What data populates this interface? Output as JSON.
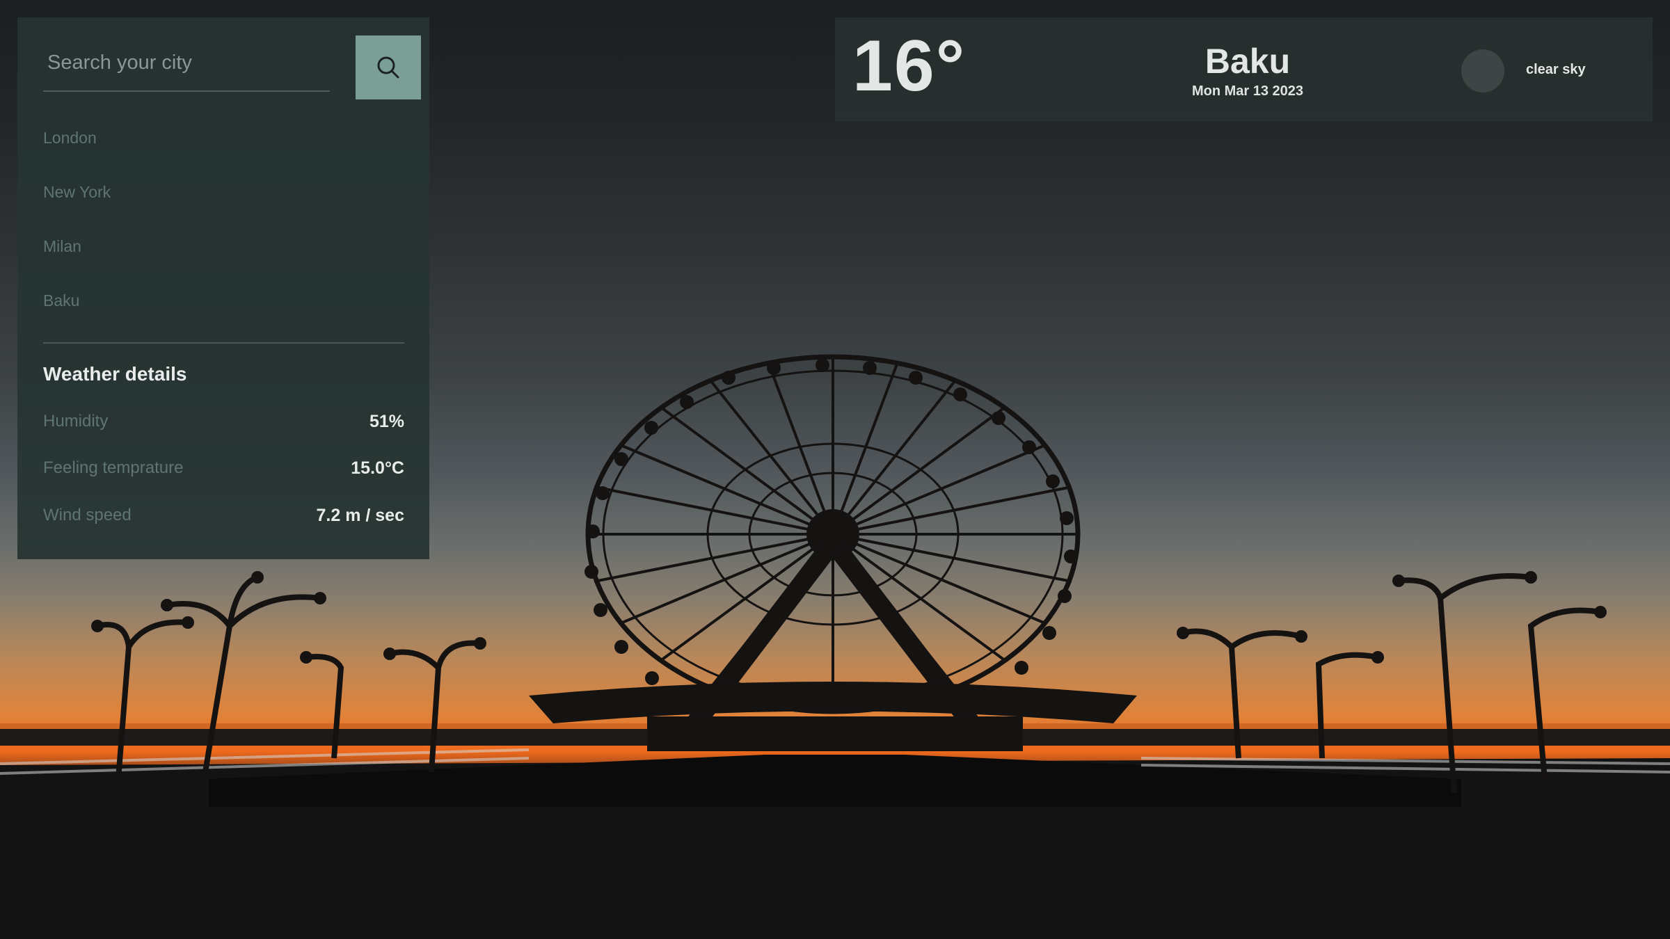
{
  "search": {
    "placeholder": "Search your city"
  },
  "cities": [
    "London",
    "New York",
    "Milan",
    "Baku"
  ],
  "details": {
    "title": "Weather details",
    "rows": [
      {
        "label": "Humidity",
        "value": "51%"
      },
      {
        "label": "Feeling temprature",
        "value": "15.0°C"
      },
      {
        "label": "Wind speed",
        "value": "7.2 m / sec"
      }
    ]
  },
  "current": {
    "temperature": "16°",
    "city": "Baku",
    "date": "Mon Mar 13 2023",
    "description": "clear sky",
    "icon": "weather-condition-icon"
  },
  "colors": {
    "accent": "#7b9e97",
    "panel": "#263432",
    "muted_text": "#5f7572"
  },
  "background": "photo of the Baku ferris wheel silhouetted against a sunset on the seaside boulevard"
}
